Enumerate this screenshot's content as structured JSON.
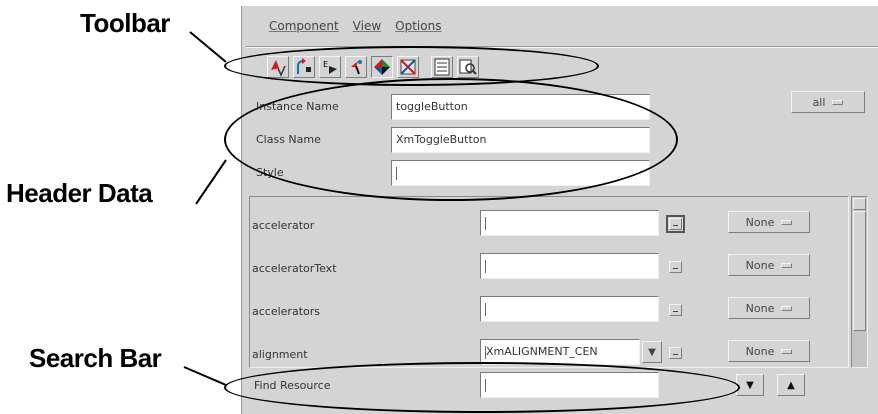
{
  "callouts": {
    "toolbar": "Toolbar",
    "header_data": "Header Data",
    "search_bar": "Search Bar"
  },
  "menu": [
    "Component",
    "View",
    "Options"
  ],
  "toolbar_icons": [
    "add-resource-icon",
    "copy-icon",
    "paste-icon",
    "cut-icon",
    "color-icon",
    "clear-icon",
    "list-icon",
    "search-view-icon"
  ],
  "header": {
    "instance_label": "Instance Name",
    "instance_value": "toggleButton",
    "class_label": "Class Name",
    "class_value": "XmToggleButton",
    "style_label": "Style",
    "style_value": "",
    "filter_value": "all"
  },
  "resources": [
    {
      "name": "accelerator",
      "value": "",
      "option": "None"
    },
    {
      "name": "acceleratorText",
      "value": "",
      "option": "None"
    },
    {
      "name": "accelerators",
      "value": "",
      "option": "None"
    },
    {
      "name": "alignment",
      "value": "XmALIGNMENT_CEN",
      "option": "None"
    }
  ],
  "search": {
    "label": "Find Resource",
    "value": "",
    "down_glyph": "▼",
    "up_glyph": "▲"
  }
}
